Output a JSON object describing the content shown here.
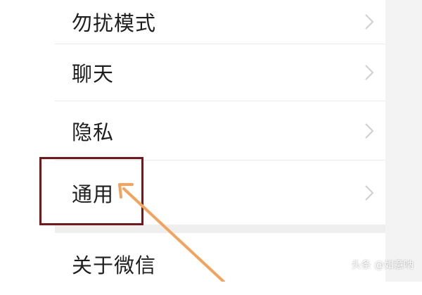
{
  "settings": {
    "items": [
      {
        "label": "勿扰模式"
      },
      {
        "label": "聊天"
      },
      {
        "label": "隐私"
      },
      {
        "label": "通用"
      },
      {
        "label": "关于微信"
      }
    ]
  },
  "annotation": {
    "highlight_color": "#7b1418",
    "arrow_color": "#f5a25a"
  },
  "watermark": {
    "text": "头条 @如意呐"
  }
}
